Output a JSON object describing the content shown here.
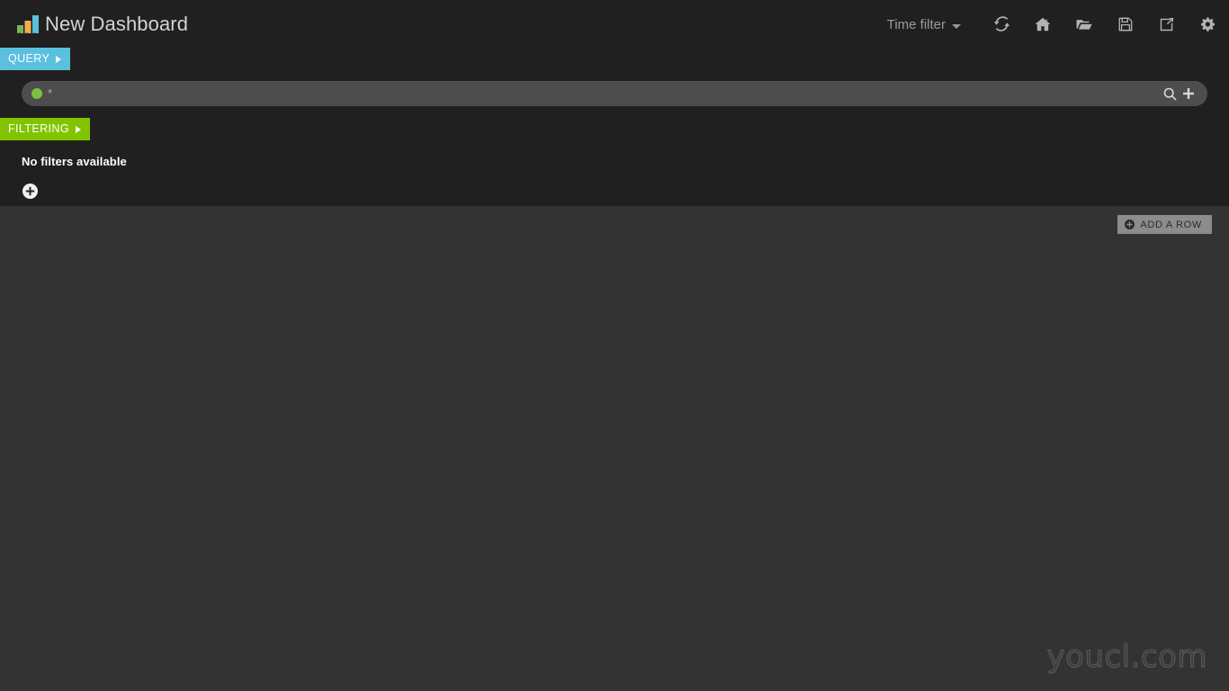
{
  "window": {
    "title": "New Dashboard",
    "background": "#333333",
    "panel_background": "#202020"
  },
  "header": {
    "logo_icon": "bar-chart-logo-icon",
    "logo_bar_colors": [
      "#7ab55c",
      "#f0ad4e",
      "#5bc0de"
    ],
    "title": "New Dashboard",
    "time_filter": {
      "label": "Time filter",
      "caret_icon": "chevron-down-icon"
    },
    "icons": [
      {
        "name": "refresh-icon",
        "title": "Refresh"
      },
      {
        "name": "home-icon",
        "title": "Home"
      },
      {
        "name": "folder-open-icon",
        "title": "Load"
      },
      {
        "name": "save-icon",
        "title": "Save"
      },
      {
        "name": "share-icon",
        "title": "Share"
      },
      {
        "name": "gear-icon",
        "title": "Configure"
      }
    ]
  },
  "query_section": {
    "tab_label": "QUERY",
    "tab_color": "#5bc0de",
    "tab_arrow_icon": "triangle-right-icon",
    "query": {
      "dot_color": "#7ac143",
      "value": "*",
      "placeholder": "*"
    },
    "search_icon": "search-icon",
    "add_icon": "plus-icon"
  },
  "filtering_section": {
    "tab_label": "FILTERING",
    "tab_color": "#82c400",
    "tab_arrow_icon": "triangle-right-icon",
    "empty_message": "No filters available",
    "add_filter_icon": "plus-circle-icon"
  },
  "dashboard_body": {
    "add_row_label": "ADD A ROW",
    "add_row_icon": "plus-circle-icon",
    "rows": []
  },
  "watermark": {
    "text": "youcl.com"
  }
}
